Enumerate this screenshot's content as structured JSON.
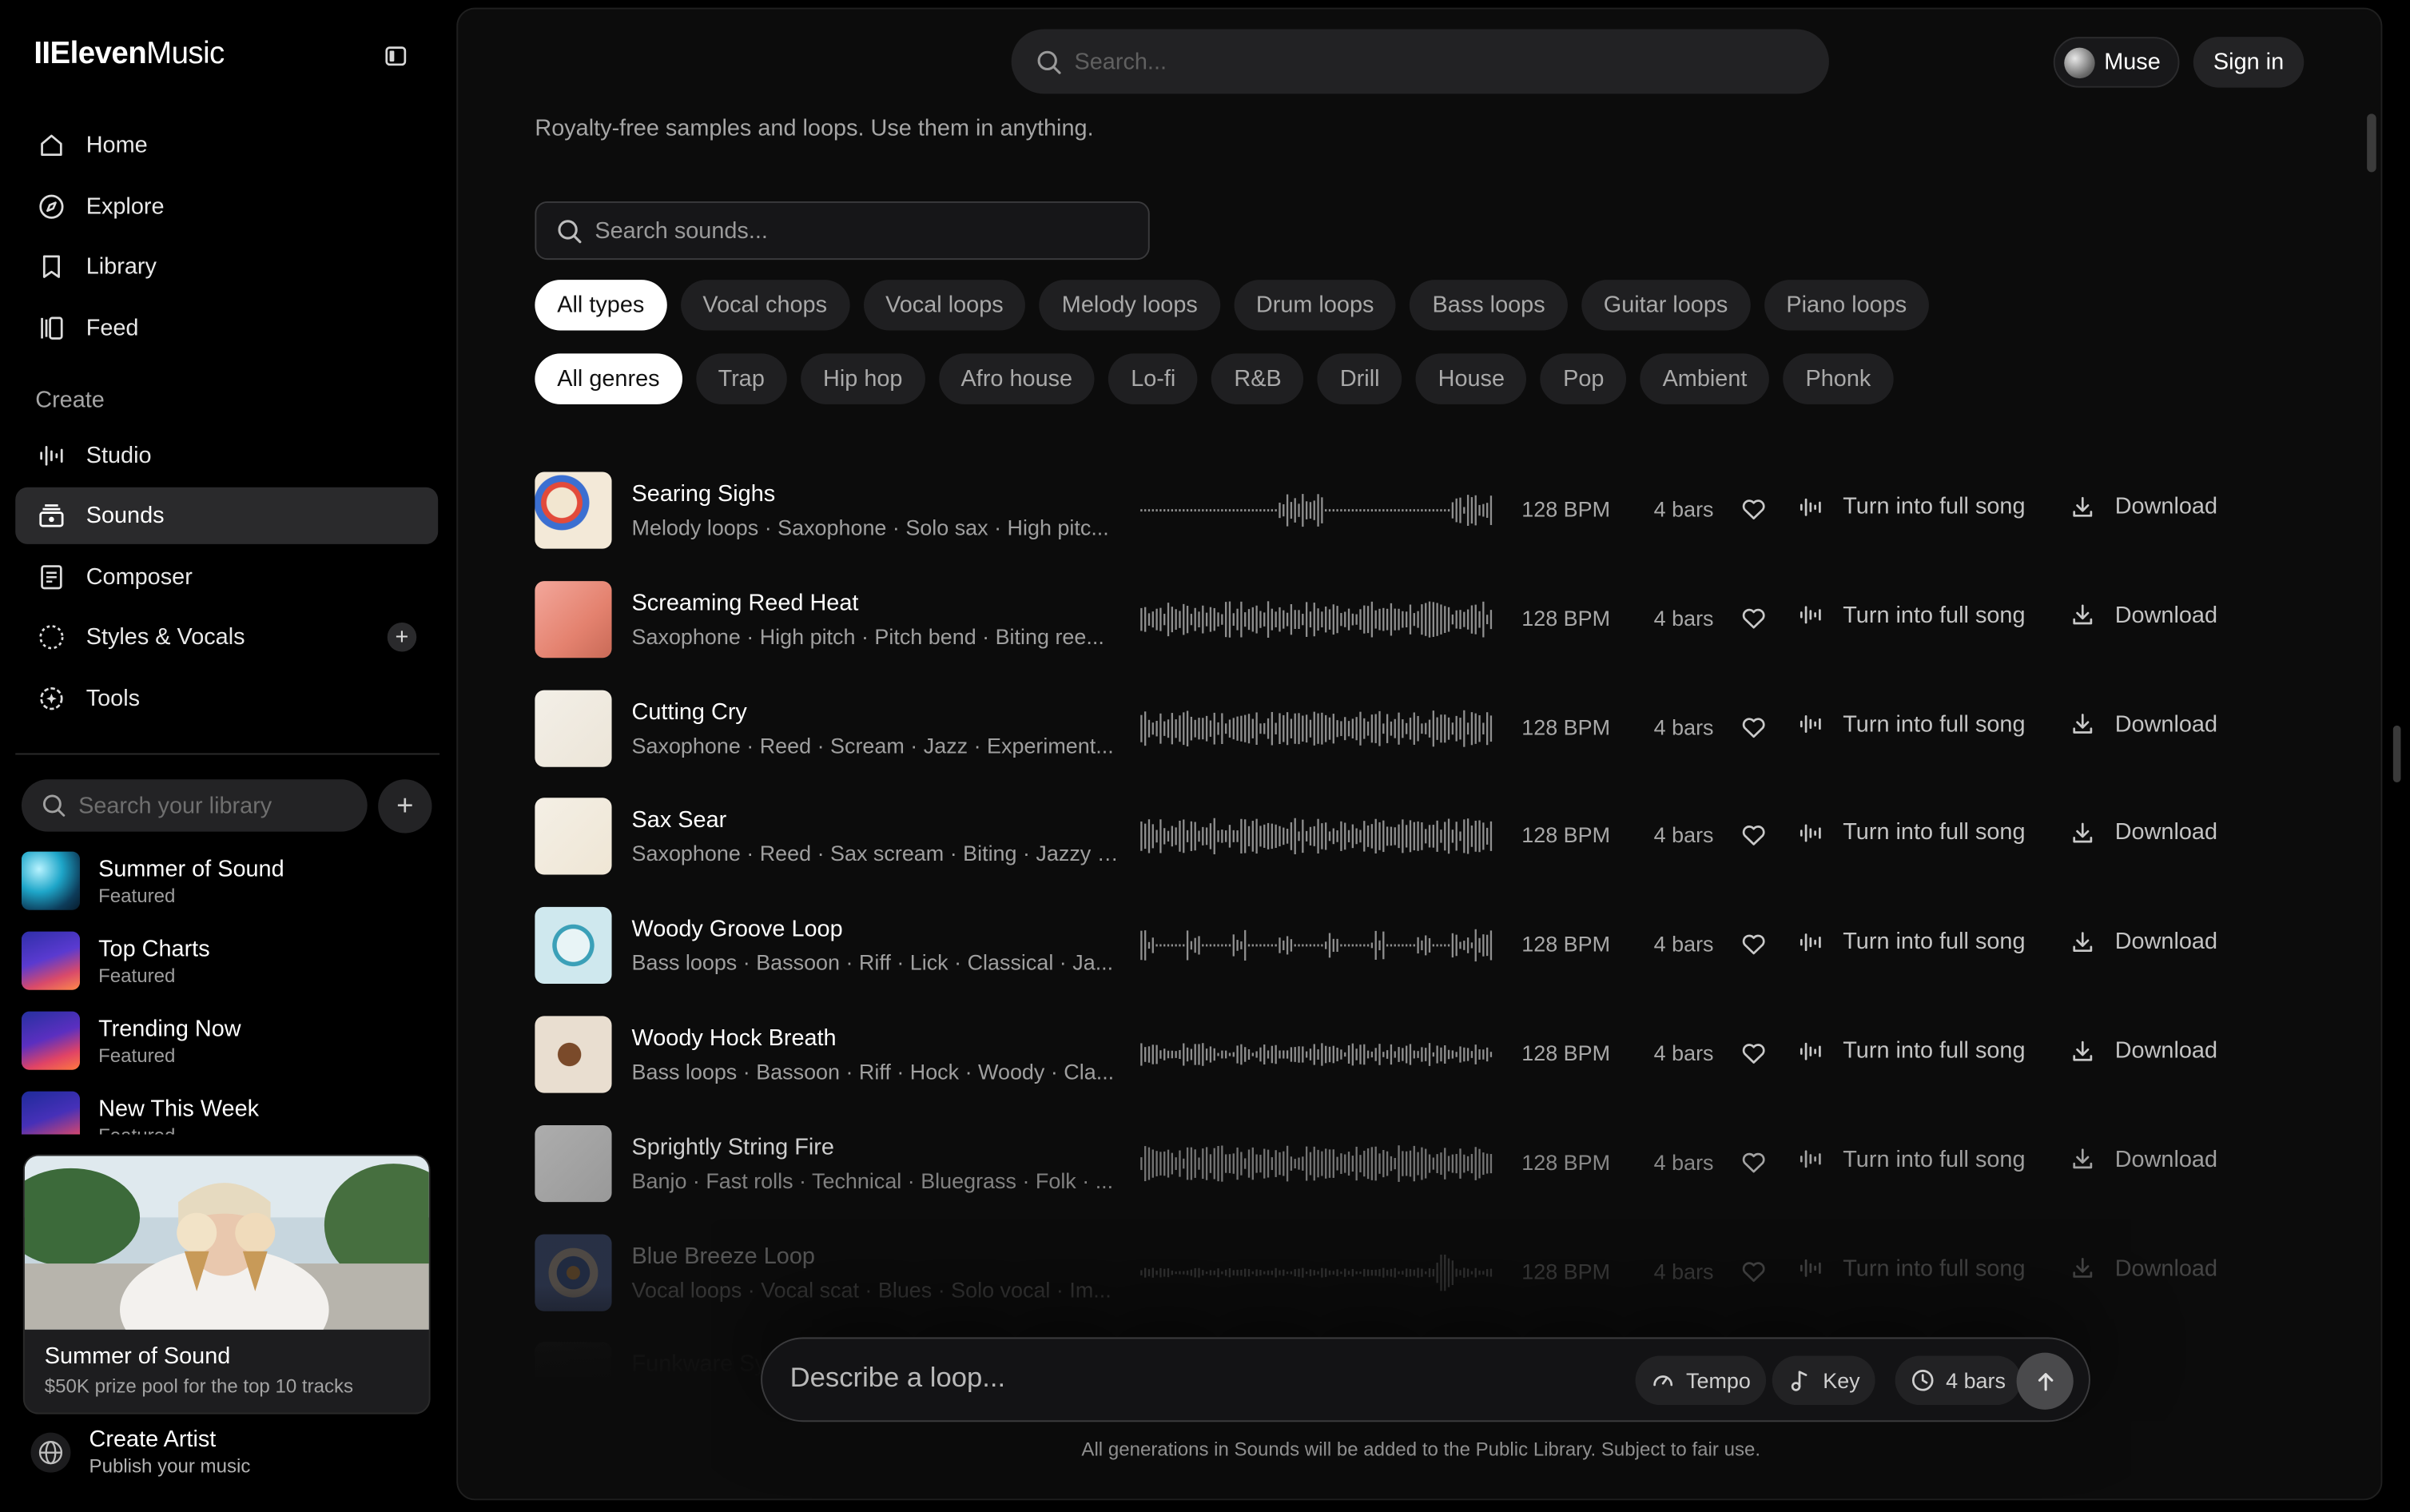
{
  "brand": {
    "prefix": "II",
    "bold": "Eleven",
    "light": "Music"
  },
  "nav": [
    {
      "label": "Home",
      "icon": "home-icon"
    },
    {
      "label": "Explore",
      "icon": "compass-icon"
    },
    {
      "label": "Library",
      "icon": "bookmark-icon"
    },
    {
      "label": "Feed",
      "icon": "feed-icon"
    }
  ],
  "create_section": {
    "label": "Create"
  },
  "create_nav": [
    {
      "label": "Studio",
      "icon": "studio-icon"
    },
    {
      "label": "Sounds",
      "icon": "sounds-icon",
      "active": true
    },
    {
      "label": "Composer",
      "icon": "composer-icon"
    },
    {
      "label": "Styles & Vocals",
      "icon": "styles-icon"
    },
    {
      "label": "Tools",
      "icon": "tools-icon"
    }
  ],
  "library": {
    "search_placeholder": "Search your library",
    "items": [
      {
        "title": "Summer of Sound",
        "sub": "Featured"
      },
      {
        "title": "Top Charts",
        "sub": "Featured"
      },
      {
        "title": "Trending Now",
        "sub": "Featured"
      },
      {
        "title": "New This Week",
        "sub": "Featured"
      }
    ]
  },
  "promo": {
    "title": "Summer of Sound",
    "sub": "$50K prize pool for the top 10 tracks"
  },
  "create_artist": {
    "title": "Create Artist",
    "sub": "Publish your music"
  },
  "header": {
    "search_placeholder": "Search...",
    "muse_label": "Muse",
    "signin_label": "Sign in"
  },
  "page": {
    "subtitle": "Royalty-free samples and loops. Use them in anything.",
    "sound_search_placeholder": "Search sounds..."
  },
  "type_filters": [
    "All types",
    "Vocal chops",
    "Vocal loops",
    "Melody loops",
    "Drum loops",
    "Bass loops",
    "Guitar loops",
    "Piano loops"
  ],
  "genre_filters": [
    "All genres",
    "Trap",
    "Hip hop",
    "Afro house",
    "Lo-fi",
    "R&B",
    "Drill",
    "House",
    "Pop",
    "Ambient",
    "Phonk"
  ],
  "sounds": [
    {
      "title": "Searing Sighs",
      "tags": "Melody loops · Saxophone · Solo sax · High pitc...",
      "bpm": "128 BPM",
      "bars": "4 bars",
      "action": "Turn into full song",
      "download": "Download"
    },
    {
      "title": "Screaming Reed Heat",
      "tags": "Saxophone · High pitch · Pitch bend · Biting ree...",
      "bpm": "128 BPM",
      "bars": "4 bars",
      "action": "Turn into full song",
      "download": "Download"
    },
    {
      "title": "Cutting Cry",
      "tags": "Saxophone · Reed · Scream · Jazz · Experiment...",
      "bpm": "128 BPM",
      "bars": "4 bars",
      "action": "Turn into full song",
      "download": "Download"
    },
    {
      "title": "Sax Sear",
      "tags": "Saxophone · Reed · Sax scream · Biting · Jazzy ·...",
      "bpm": "128 BPM",
      "bars": "4 bars",
      "action": "Turn into full song",
      "download": "Download"
    },
    {
      "title": "Woody Groove Loop",
      "tags": "Bass loops · Bassoon · Riff · Lick · Classical · Ja...",
      "bpm": "128 BPM",
      "bars": "4 bars",
      "action": "Turn into full song",
      "download": "Download"
    },
    {
      "title": "Woody Hock Breath",
      "tags": "Bass loops · Bassoon · Riff · Hock · Woody · Cla...",
      "bpm": "128 BPM",
      "bars": "4 bars",
      "action": "Turn into full song",
      "download": "Download"
    },
    {
      "title": "Sprightly String Fire",
      "tags": "Banjo · Fast rolls · Technical · Bluegrass · Folk · ...",
      "bpm": "128 BPM",
      "bars": "4 bars",
      "action": "Turn into full song",
      "download": "Download"
    },
    {
      "title": "Blue Breeze Loop",
      "tags": "Vocal loops · Vocal scat · Blues · Solo vocal · Im...",
      "bpm": "128 BPM",
      "bars": "4 bars",
      "action": "Turn into full song",
      "download": "Download"
    },
    {
      "title": "Funkware Sy",
      "tags": "",
      "bpm": "",
      "bars": "",
      "action": "",
      "download": ""
    }
  ],
  "prompt": {
    "placeholder": "Describe a loop...",
    "tempo_label": "Tempo",
    "key_label": "Key",
    "bars_label": "4 bars",
    "footnote": "All generations in Sounds will be added to the Public Library. Subject to fair use."
  }
}
